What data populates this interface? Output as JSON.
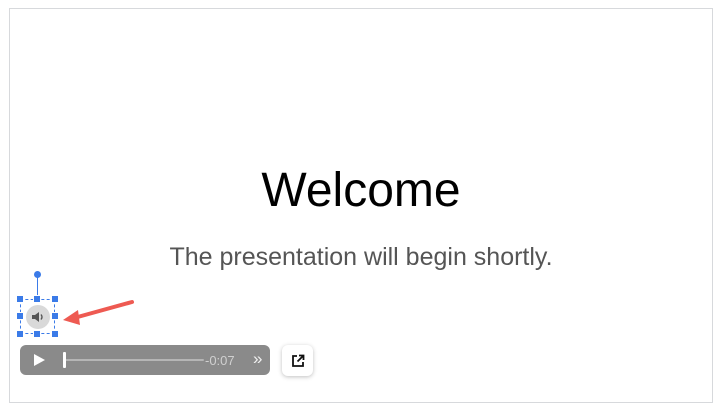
{
  "slide": {
    "title": "Welcome",
    "subtitle": "The presentation will begin shortly."
  },
  "audio": {
    "icon": "speaker-icon",
    "selected": true,
    "player": {
      "play_icon": "play-icon",
      "progress": 0.0,
      "time_remaining": "-0:07",
      "fast_forward_icon": "fast-forward-icon",
      "open_external_icon": "open-external-icon"
    }
  },
  "colors": {
    "selection": "#3b7be8",
    "annotation_arrow": "#ee5a52",
    "player_bg": "#8a8a8a"
  }
}
